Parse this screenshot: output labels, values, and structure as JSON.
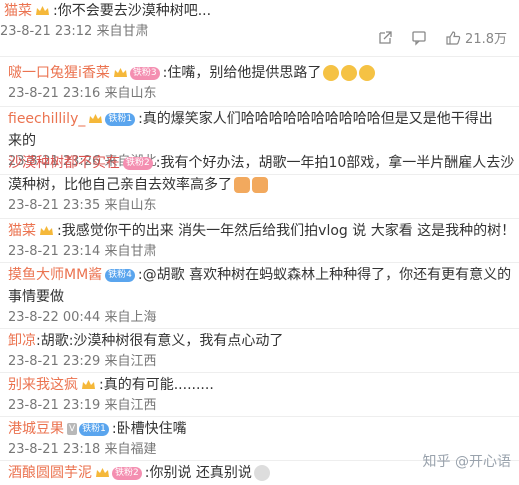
{
  "comments": [
    {
      "user": "猫菜",
      "badges": [
        "crown"
      ],
      "text": ":你不会要去沙漠种树吧...",
      "meta": "23-8-21 23:12 来自甘肃",
      "has_icons": true,
      "likes": "21.8万"
    },
    {
      "user": "啵一口兔猩i香菜",
      "badges": [
        "crown",
        "pill-pink:铁粉3"
      ],
      "text": ":住嘴，别给他提供思路了",
      "emoji": 3,
      "meta": "23-8-21 23:16 来自山东"
    },
    {
      "user": "fieechillily_",
      "badges": [
        "crown",
        "pill-blue:铁粉1"
      ],
      "text": ":真的爆笑家人们哈哈哈哈哈哈哈哈哈哈但是又是他干得出",
      "text2": "来的",
      "meta": "23-8-21 23:26 来自湖北"
    },
    {
      "user": "沙漠种树都不实在",
      "badges": [
        "pill-pink:铁粉2"
      ],
      "text": ":我有个好办法，胡歌一年拍10部戏，拿一半片酬雇人去沙",
      "text2": "漠种树，比他自己亲自去效率高多了",
      "emoji": 2,
      "meta": "23-8-21 23:35 来自山东"
    },
    {
      "user": "猫菜",
      "badges": [
        "crown"
      ],
      "text": ":我感觉你干的出来 消失一年然后给我们拍vlog 说 大家看 这是我种的树！",
      "meta": "23-8-21 23:14 来自甘肃"
    },
    {
      "user": "摸鱼大师MM酱",
      "badges": [
        "pill-blue:铁粉4"
      ],
      "text": ":@胡歌 喜欢种树在蚂蚁森林上种种得了，你还有更有意义的",
      "text2": "事情要做",
      "meta": "23-8-22 00:44 来自上海"
    },
    {
      "user": "卸凉",
      "badges": [],
      "text": ":胡歌:沙漠种树很有意义，我有点心动了",
      "meta": "23-8-21 23:29 来自江西"
    },
    {
      "user": "别来我这疯",
      "badges": [
        "crown"
      ],
      "text": ":真的有可能.........",
      "meta": "23-8-21 23:19 来自江西"
    },
    {
      "user": "港城豆果",
      "badges": [
        "vip",
        "pill-blue:铁粉1"
      ],
      "text": ":卧槽快住嘴",
      "meta": "23-8-21 23:18 来自福建"
    },
    {
      "user": "酒酿圆圆芋泥",
      "badges": [
        "crown",
        "pill-pink:铁粉2"
      ],
      "text": ":你别说 还真别说",
      "emoji": 1,
      "meta": ""
    }
  ],
  "watermark": "知乎 @开心语"
}
